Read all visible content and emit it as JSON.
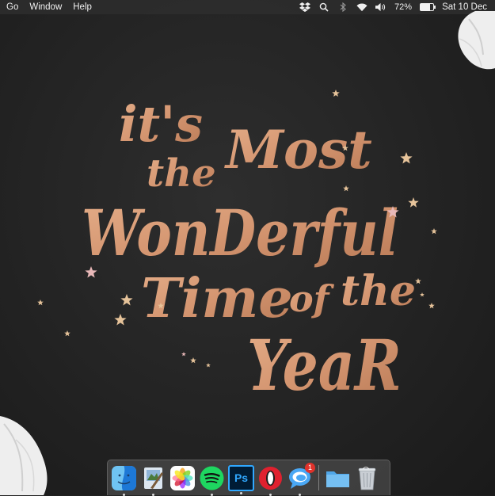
{
  "menubar": {
    "menus": [
      "Go",
      "Window",
      "Help"
    ],
    "status_icons": [
      "dropbox-icon",
      "search-icon",
      "bluetooth-icon",
      "wifi-icon",
      "volume-icon"
    ],
    "battery_percent": "72%",
    "battery_level": 0.72,
    "clock": "Sat 10 Dec"
  },
  "wallpaper": {
    "lines": [
      "it's",
      "the",
      "Most",
      "WonDerful",
      "Time",
      "of",
      "the",
      "YeaR"
    ],
    "colors": {
      "copper": "#e4ad88",
      "copper_dark": "#b97a56",
      "star_gold": "#e6c39a",
      "star_pink": "#e8b8b8"
    }
  },
  "dock": {
    "apps": [
      {
        "name": "Finder",
        "icon": "finder-icon",
        "running": true
      },
      {
        "name": "Preview",
        "icon": "preview-icon",
        "running": true
      },
      {
        "name": "Photos",
        "icon": "photos-icon",
        "running": false
      },
      {
        "name": "Spotify",
        "icon": "spotify-icon",
        "running": true
      },
      {
        "name": "Photoshop",
        "icon": "photoshop-icon",
        "label": "Ps",
        "running": true
      },
      {
        "name": "Opera",
        "icon": "opera-icon",
        "running": true
      },
      {
        "name": "Messages",
        "icon": "messages-icon",
        "badge": "1",
        "running": true
      },
      {
        "name": "Folder",
        "icon": "folder-icon",
        "running": false
      },
      {
        "name": "Trash",
        "icon": "trash-icon",
        "running": false
      }
    ]
  }
}
